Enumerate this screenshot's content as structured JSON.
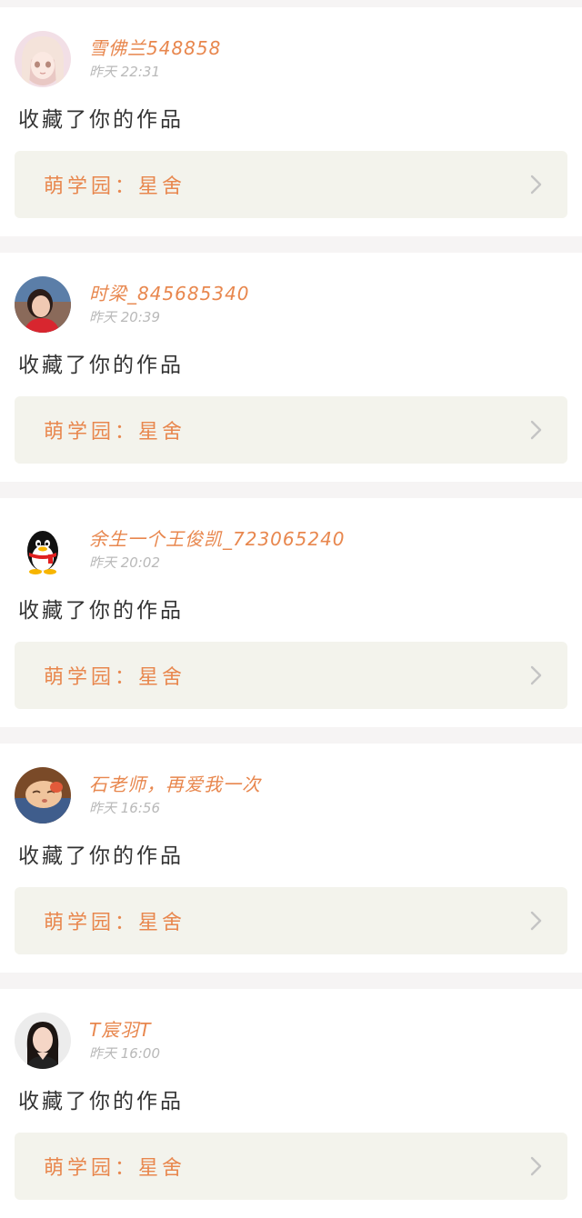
{
  "colors": {
    "accent": "#e8874e",
    "time_text": "#b9b9b9",
    "body_text": "#333333",
    "card_bg": "#ffffff",
    "link_bg": "#f3f3ec",
    "page_bg": "#f6f4f4"
  },
  "feed": [
    {
      "username": "雪佛兰548858",
      "time": "昨天 22:31",
      "action": "收藏了你的作品",
      "work_label": "萌学园：星舍",
      "avatar_icon": "anime-girl-avatar-icon"
    },
    {
      "username": "时梁_845685340",
      "time": "昨天 20:39",
      "action": "收藏了你的作品",
      "work_label": "萌学园：星舍",
      "avatar_icon": "girl-photo-avatar-icon"
    },
    {
      "username": "余生一个王俊凯_723065240",
      "time": "昨天 20:02",
      "action": "收藏了你的作品",
      "work_label": "萌学园：星舍",
      "avatar_icon": "qq-penguin-avatar-icon"
    },
    {
      "username": "石老师，再爱我一次",
      "time": "昨天 16:56",
      "action": "收藏了你的作品",
      "work_label": "萌学园：星舍",
      "avatar_icon": "sleeping-face-avatar-icon"
    },
    {
      "username": "T宸羽T",
      "time": "昨天 16:00",
      "action": "收藏了你的作品",
      "work_label": "萌学园：星舍",
      "avatar_icon": "woman-portrait-avatar-icon"
    }
  ]
}
